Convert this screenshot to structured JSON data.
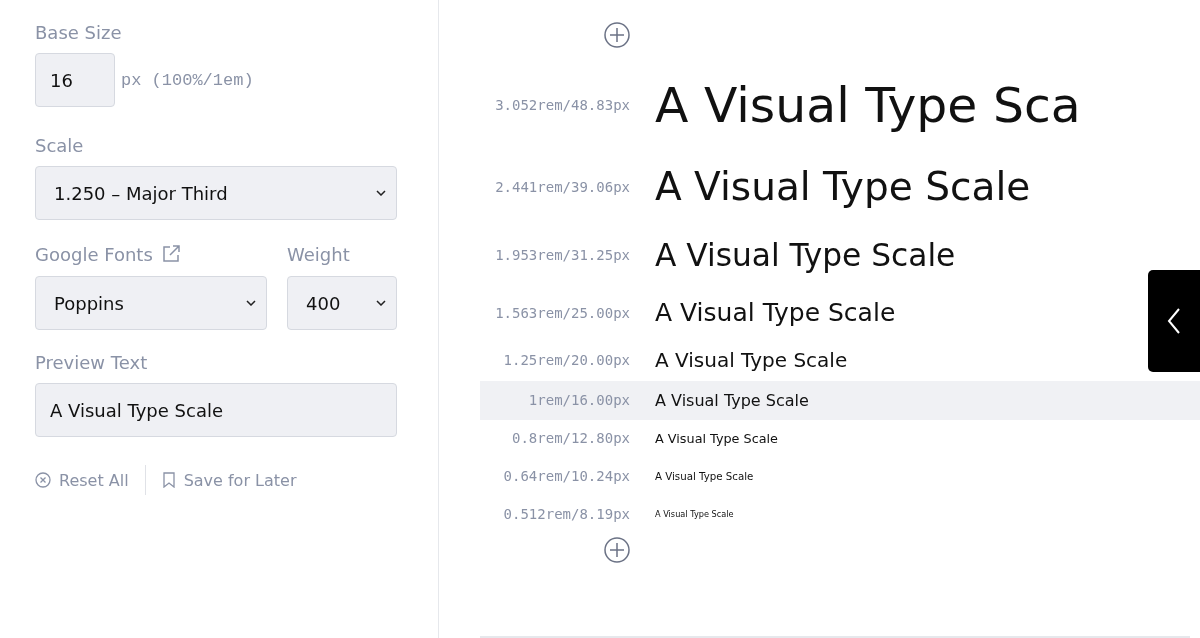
{
  "base_size": {
    "label": "Base Size",
    "value": "16",
    "unit": "px (100%/1em)"
  },
  "scale": {
    "label": "Scale",
    "value": "1.250 – Major Third"
  },
  "google_fonts": {
    "label": "Google Fonts",
    "value": "Poppins"
  },
  "weight": {
    "label": "Weight",
    "value": "400"
  },
  "preview_text": {
    "label": "Preview Text",
    "value": "A Visual Type Scale"
  },
  "actions": [
    {
      "label": "Reset All",
      "kind": "reset"
    },
    {
      "label": "Save for Later",
      "kind": "save"
    }
  ],
  "scale_rows": [
    {
      "size": "3.052rem/48.83px",
      "sample": "A Visual Type Sca",
      "selected": false
    },
    {
      "size": "2.441rem/39.06px",
      "sample": "A Visual Type Scale",
      "selected": false
    },
    {
      "size": "1.953rem/31.25px",
      "sample": "A Visual Type Scale",
      "selected": false
    },
    {
      "size": "1.563rem/25.00px",
      "sample": "A Visual Type Scale",
      "selected": false
    },
    {
      "size": "1.25rem/20.00px",
      "sample": "A Visual Type Scale",
      "selected": false
    },
    {
      "size": "1rem/16.00px",
      "sample": "A Visual Type Scale",
      "selected": true
    },
    {
      "size": "0.8rem/12.80px",
      "sample": "A Visual Type Scale",
      "selected": false
    },
    {
      "size": "0.64rem/10.24px",
      "sample": "A Visual Type Scale",
      "selected": false
    },
    {
      "size": "0.512rem/8.19px",
      "sample": "A Visual Type Scale",
      "selected": false
    }
  ]
}
